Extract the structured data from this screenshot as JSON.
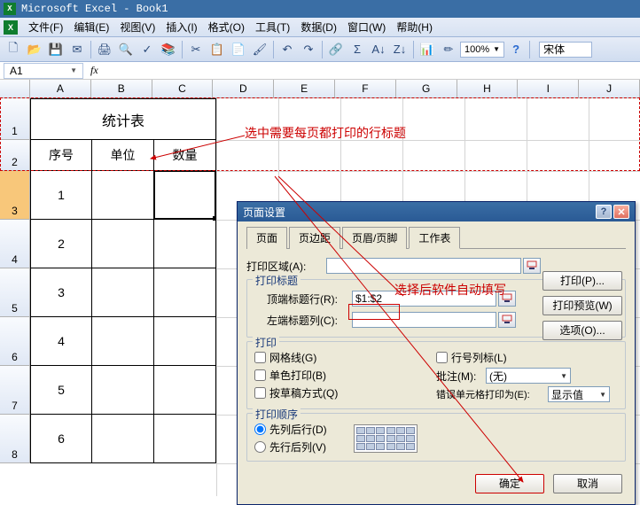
{
  "app": {
    "title": "Microsoft Excel - Book1"
  },
  "menu": {
    "file": "文件(F)",
    "edit": "编辑(E)",
    "view": "视图(V)",
    "insert": "插入(I)",
    "format": "格式(O)",
    "tools": "工具(T)",
    "data": "数据(D)",
    "window": "窗口(W)",
    "help": "帮助(H)"
  },
  "toolbar": {
    "zoom": "100%",
    "font": "宋体"
  },
  "namebox": {
    "value": "A1",
    "fx": "fx"
  },
  "cols": [
    "A",
    "B",
    "C",
    "D",
    "E",
    "F",
    "G",
    "H",
    "I",
    "J"
  ],
  "rows": [
    "1",
    "2",
    "3",
    "4",
    "5",
    "6",
    "7",
    "8"
  ],
  "table": {
    "title": "统计表",
    "h1": "序号",
    "h2": "单位",
    "h3": "数量",
    "r1": "1",
    "r2": "2",
    "r3": "3",
    "r4": "4",
    "r5": "5",
    "r6": "6"
  },
  "annotations": {
    "a1": "选中需要每页都打印的行标题",
    "a2": "选择后软件自动填写"
  },
  "dialog": {
    "title": "页面设置",
    "tabs": {
      "page": "页面",
      "margin": "页边距",
      "header": "页眉/页脚",
      "sheet": "工作表"
    },
    "print_area_lbl": "打印区域(A):",
    "group_titles": "打印标题",
    "top_row_lbl": "顶端标题行(R):",
    "top_row_val": "$1:$2",
    "left_col_lbl": "左端标题列(C):",
    "group_print": "打印",
    "grid": "网格线(G)",
    "mono": "单色打印(B)",
    "draft": "按草稿方式(Q)",
    "rowcol": "行号列标(L)",
    "comment_lbl": "批注(M):",
    "comment_val": "(无)",
    "error_lbl": "错误单元格打印为(E):",
    "error_val": "显示值",
    "group_order": "打印顺序",
    "order1": "先列后行(D)",
    "order2": "先行后列(V)",
    "side": {
      "print": "打印(P)...",
      "preview": "打印预览(W)",
      "options": "选项(O)..."
    },
    "ok": "确定",
    "cancel": "取消"
  }
}
